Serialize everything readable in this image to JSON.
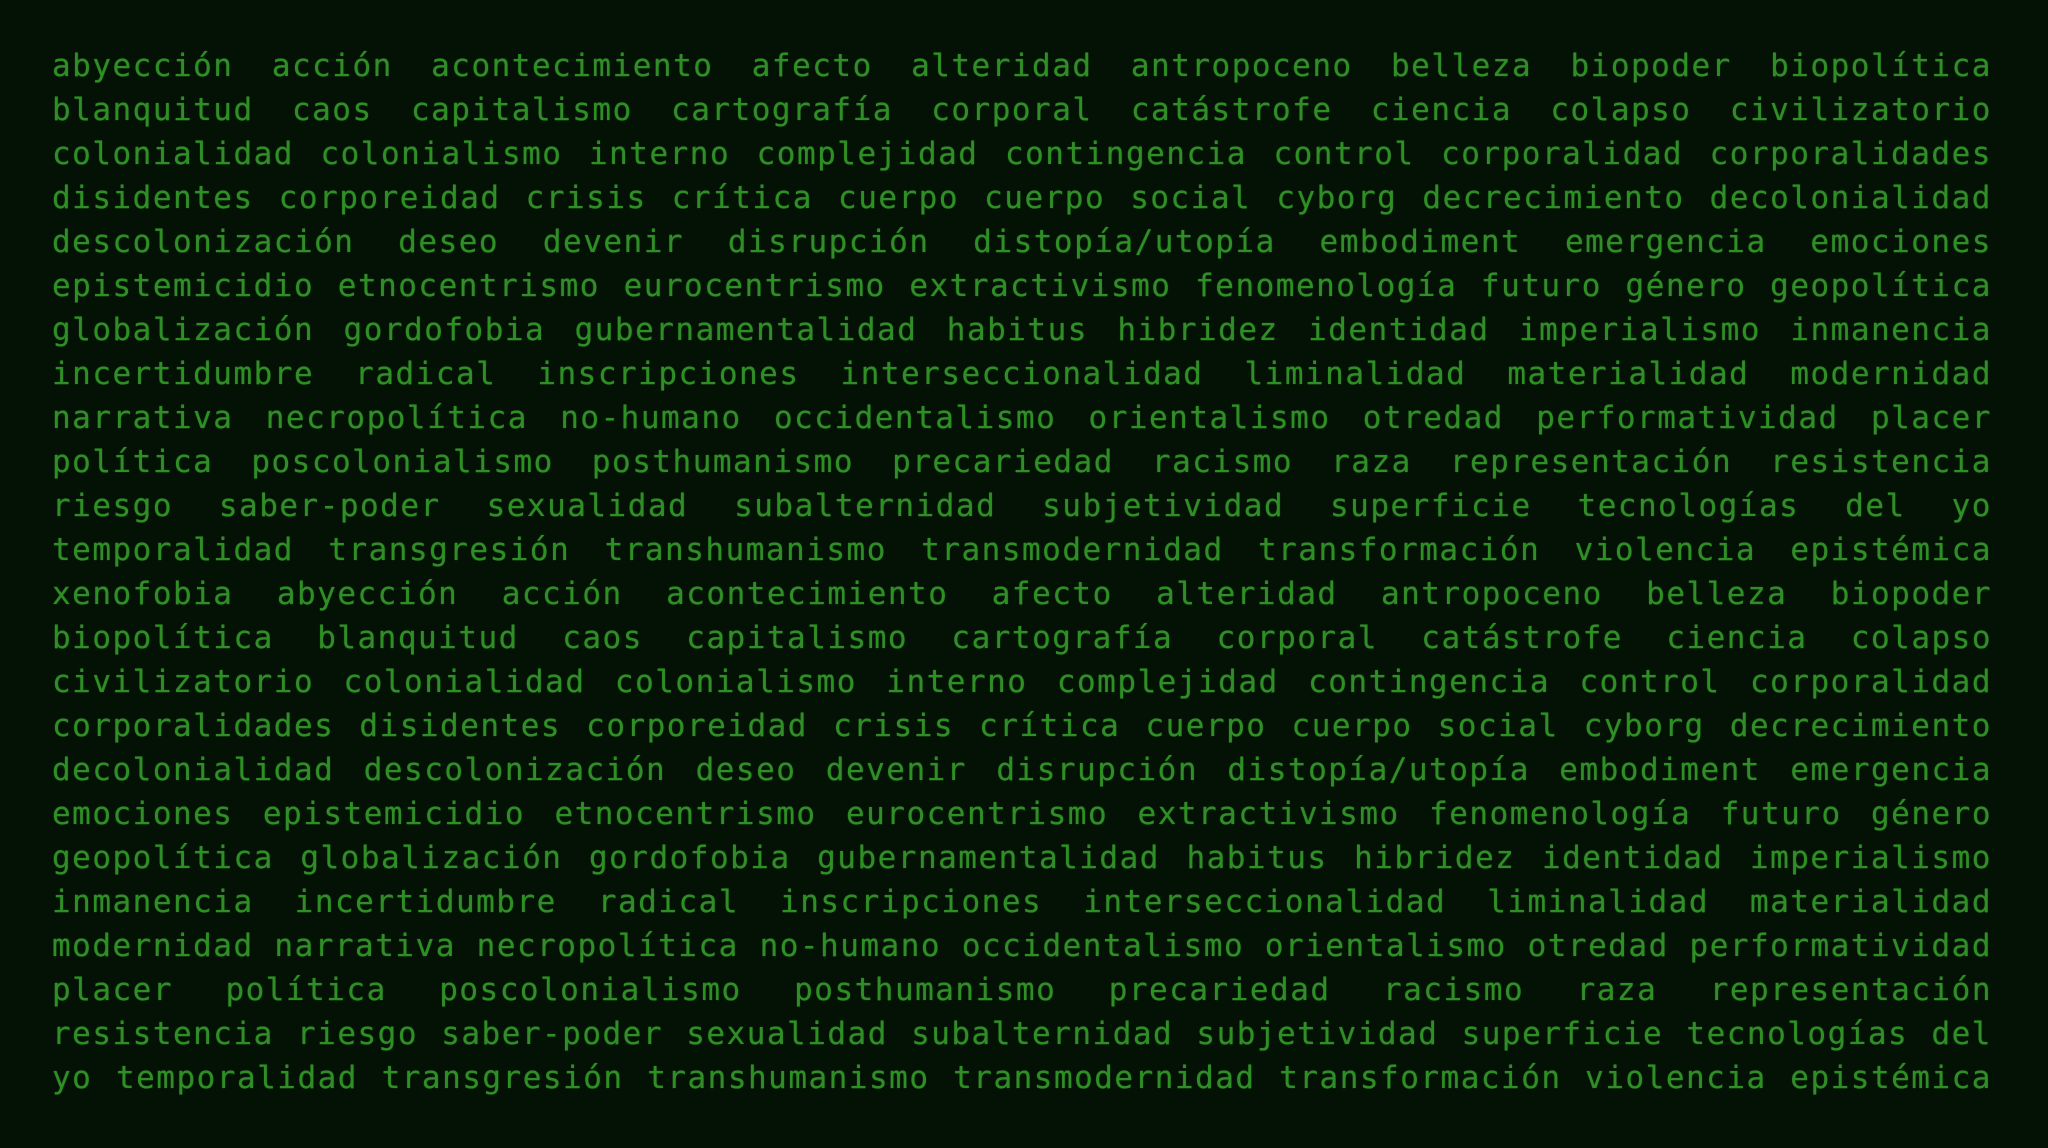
{
  "lines": [
    [
      "abyección",
      "acción",
      "acontecimiento",
      "afecto",
      "alteridad",
      "antropoceno",
      "belleza",
      "biopoder",
      "biopolítica"
    ],
    [
      "blanquitud",
      "caos",
      "capitalismo",
      "cartografía",
      "corporal",
      "catástrofe",
      "ciencia",
      "colapso",
      "civilizatorio"
    ],
    [
      "colonialidad",
      "colonialismo",
      "interno",
      "complejidad",
      "contingencia",
      "control",
      "corporalidad",
      "corporalidades"
    ],
    [
      "disidentes",
      "corporeidad",
      "crisis",
      "crítica",
      "cuerpo",
      "cuerpo",
      "social",
      "cyborg",
      "decrecimiento",
      "decolonialidad"
    ],
    [
      "descolonización",
      "deseo",
      "devenir",
      "disrupción",
      "distopía/utopía",
      "embodiment",
      "emergencia",
      "emociones"
    ],
    [
      "epistemicidio",
      "etnocentrismo",
      "eurocentrismo",
      "extractivismo",
      "fenomenología",
      "futuro",
      "género",
      "geopolítica"
    ],
    [
      "globalización",
      "gordofobia",
      "gubernamentalidad",
      "habitus",
      "hibridez",
      "identidad",
      "imperialismo",
      "inmanencia"
    ],
    [
      "incertidumbre",
      "radical",
      "inscripciones",
      "interseccionalidad",
      "liminalidad",
      "materialidad",
      "modernidad"
    ],
    [
      "narrativa",
      "necropolítica",
      "no-humano",
      "occidentalismo",
      "orientalismo",
      "otredad",
      "performatividad",
      "placer"
    ],
    [
      "política",
      "poscolonialismo",
      "posthumanismo",
      "precariedad",
      "racismo",
      "raza",
      "representación",
      "resistencia"
    ],
    [
      "riesgo",
      "saber-poder",
      "sexualidad",
      "subalternidad",
      "subjetividad",
      "superficie",
      "tecnologías",
      "del",
      "yo"
    ],
    [
      "temporalidad",
      "transgresión",
      "transhumanismo",
      "transmodernidad",
      "transformación",
      "violencia",
      "epistémica"
    ],
    [
      "xenofobia",
      "abyección",
      "acción",
      "acontecimiento",
      "afecto",
      "alteridad",
      "antropoceno",
      "belleza",
      "biopoder"
    ],
    [
      "biopolítica",
      "blanquitud",
      "caos",
      "capitalismo",
      "cartografía",
      "corporal",
      "catástrofe",
      "ciencia",
      "colapso"
    ],
    [
      "civilizatorio",
      "colonialidad",
      "colonialismo",
      "interno",
      "complejidad",
      "contingencia",
      "control",
      "corporalidad"
    ],
    [
      "corporalidades",
      "disidentes",
      "corporeidad",
      "crisis",
      "crítica",
      "cuerpo",
      "cuerpo",
      "social",
      "cyborg",
      "decrecimiento"
    ],
    [
      "decolonialidad",
      "descolonización",
      "deseo",
      "devenir",
      "disrupción",
      "distopía/utopía",
      "embodiment",
      "emergencia"
    ],
    [
      "emociones",
      "epistemicidio",
      "etnocentrismo",
      "eurocentrismo",
      "extractivismo",
      "fenomenología",
      "futuro",
      "género"
    ],
    [
      "geopolítica",
      "globalización",
      "gordofobia",
      "gubernamentalidad",
      "habitus",
      "hibridez",
      "identidad",
      "imperialismo"
    ],
    [
      "inmanencia",
      "incertidumbre",
      "radical",
      "inscripciones",
      "interseccionalidad",
      "liminalidad",
      "materialidad"
    ],
    [
      "modernidad",
      "narrativa",
      "necropolítica",
      "no-humano",
      "occidentalismo",
      "orientalismo",
      "otredad",
      "performatividad"
    ],
    [
      "placer",
      "política",
      "poscolonialismo",
      "posthumanismo",
      "precariedad",
      "racismo",
      "raza",
      "representación"
    ],
    [
      "resistencia",
      "riesgo",
      "saber-poder",
      "sexualidad",
      "subalternidad",
      "subjetividad",
      "superficie",
      "tecnologías",
      "del"
    ],
    [
      "yo",
      "temporalidad",
      "transgresión",
      "transhumanismo",
      "transmodernidad",
      "transformación",
      "violencia",
      "epistémica"
    ]
  ],
  "colors": {
    "background": "#031204",
    "text": "#2f8e25"
  }
}
